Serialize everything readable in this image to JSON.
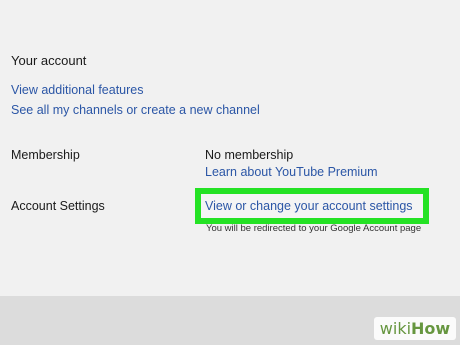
{
  "section": {
    "title": "Your account"
  },
  "links": {
    "additional_features": "View additional features",
    "channels": "See all my channels or create a new channel"
  },
  "membership": {
    "label": "Membership",
    "value": "No membership",
    "premium_link": "Learn about YouTube Premium"
  },
  "account_settings": {
    "label": "Account Settings",
    "link": "View or change your account settings",
    "note": "You will be redirected to your Google Account page"
  },
  "watermark": {
    "wiki": "wiki",
    "how": "How"
  },
  "colors": {
    "link": "#2b56a6",
    "highlight": "#24e224",
    "panel_bg": "#f1f1f1",
    "bottom_bg": "#dcdcdc"
  }
}
